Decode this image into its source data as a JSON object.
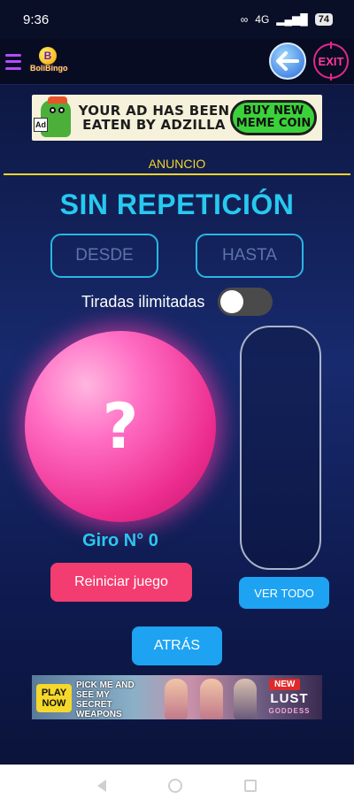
{
  "status_bar": {
    "time": "9:36",
    "network": "4G",
    "battery": "74"
  },
  "header": {
    "logo_text": "BoliBingo",
    "logo_letter": "B",
    "exit_label": "EXIT"
  },
  "ad_top": {
    "sign_text": "Ad",
    "headline": "YOUR AD HAS BEEN EATEN BY ADZILLA",
    "cta": "BUY NEW MEME COIN"
  },
  "ad_label": "ANUNCIO",
  "title": "SIN REPETICIÓN",
  "range": {
    "from_placeholder": "DESDE",
    "to_placeholder": "HASTA"
  },
  "toggle": {
    "label": "Tiradas ilimitadas",
    "on": false
  },
  "ball": {
    "symbol": "?"
  },
  "spin_count": "Giro N° 0",
  "buttons": {
    "reset": "Reiniciar juego",
    "view_all": "VER TODO",
    "back": "ATRÁS"
  },
  "ad_bottom": {
    "play_now": "PLAY NOW",
    "promo": "PICK ME AND SEE MY SECRET WEAPONS",
    "badge": "NEW",
    "game_title": "LUST",
    "game_subtitle": "GODDESS"
  },
  "colors": {
    "accent_cyan": "#27c9f0",
    "ball_pink": "#ec2c8e",
    "reset_red": "#f33c6f",
    "button_blue": "#1da3f2",
    "ad_yellow": "#f5d42a"
  }
}
